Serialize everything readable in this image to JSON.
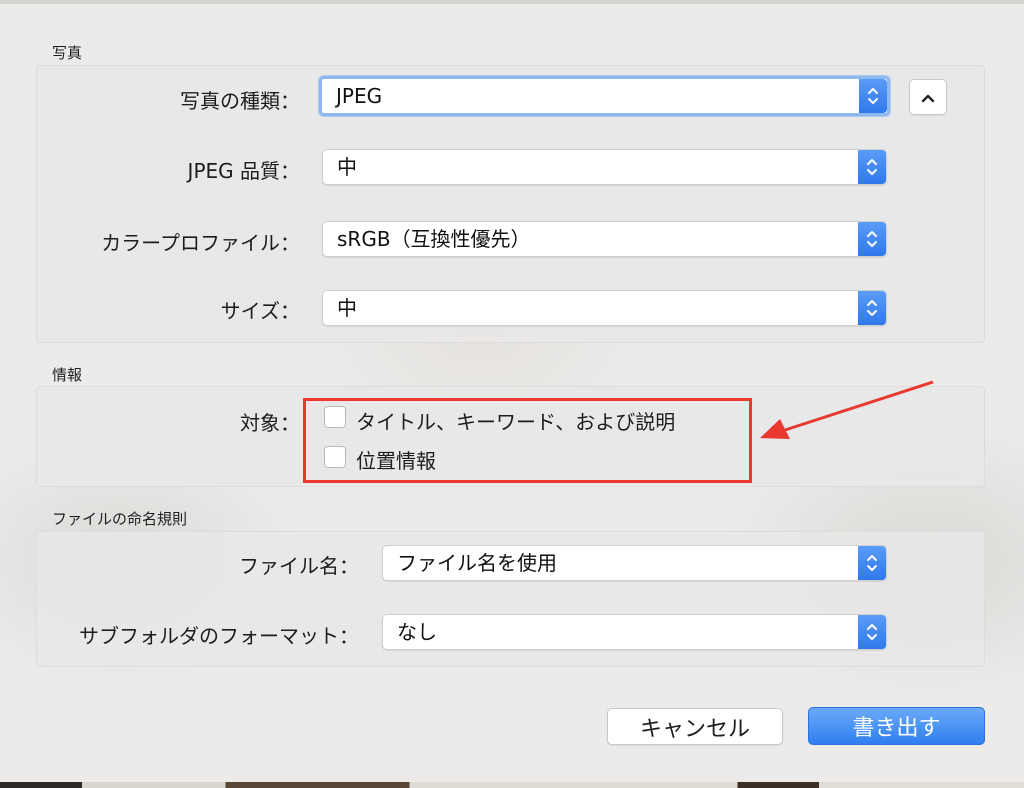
{
  "photo_section": {
    "title": "写真",
    "type_label": "写真の種類：",
    "type_value": "JPEG",
    "quality_label": "JPEG 品質：",
    "quality_value": "中",
    "profile_label": "カラープロファイル：",
    "profile_value": "sRGB（互換性優先）",
    "size_label": "サイズ：",
    "size_value": "中"
  },
  "info_section": {
    "title": "情報",
    "target_label": "対象：",
    "option_title_keywords": "タイトル、キーワード、および説明",
    "option_location": "位置情報"
  },
  "naming_section": {
    "title": "ファイルの命名規則",
    "filename_label": "ファイル名：",
    "filename_value": "ファイル名を使用",
    "subfolder_label": "サブフォルダのフォーマット：",
    "subfolder_value": "なし"
  },
  "buttons": {
    "cancel": "キャンセル",
    "export": "書き出す"
  },
  "colors": {
    "accent": "#2f78ec",
    "annotation": "#e8382f"
  },
  "icons": [
    "stepper-icon",
    "chevron-up-icon",
    "annotation-arrow"
  ]
}
